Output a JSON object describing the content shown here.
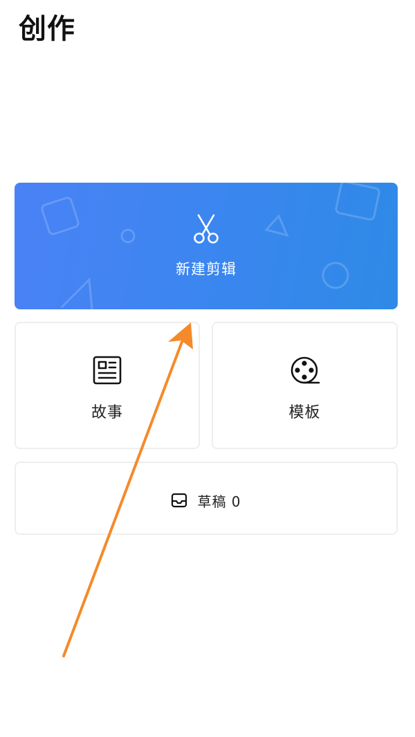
{
  "header": {
    "title": "创作"
  },
  "new_edit": {
    "label": "新建剪辑",
    "icon": "scissors-icon",
    "gradient_start": "#4a82f5",
    "gradient_end": "#2e8ae6"
  },
  "story": {
    "label": "故事",
    "icon": "newspaper-icon"
  },
  "template": {
    "label": "模板",
    "icon": "film-reel-icon"
  },
  "drafts": {
    "label": "草稿 0",
    "icon": "inbox-icon"
  },
  "annotation": {
    "arrow_color": "#f58a2a"
  }
}
